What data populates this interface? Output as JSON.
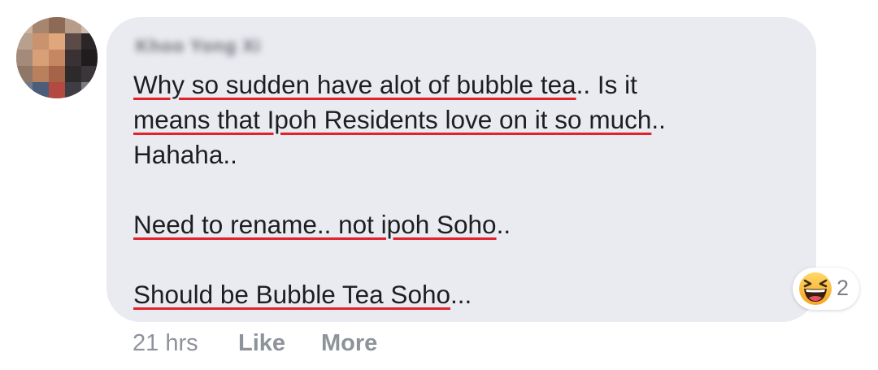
{
  "comment": {
    "author": "Khoo Yong Xi",
    "lines": [
      {
        "spelled": "Why so sudden have alot of bubble tea",
        "rest": ".. Is it"
      },
      {
        "spelled": "means that Ipoh Residents love on it so much",
        "rest": ".."
      },
      {
        "spelled": "",
        "rest": "Hahaha.."
      },
      {
        "spelled": "Need to rename.. not ipoh Soho",
        "rest": ".."
      },
      {
        "spelled": "Should be Bubble Tea Soho",
        "rest": "..."
      }
    ],
    "reaction": {
      "icon": "laughing-emoji-icon",
      "count": "2"
    },
    "actions": {
      "timestamp": "21 hrs",
      "like_label": "Like",
      "more_label": "More"
    }
  },
  "colors": {
    "bubble_background": "#eaebf0",
    "spellcheck_underline": "#e0242b",
    "text": "#1c1e21",
    "action_text": "#8e939a"
  }
}
